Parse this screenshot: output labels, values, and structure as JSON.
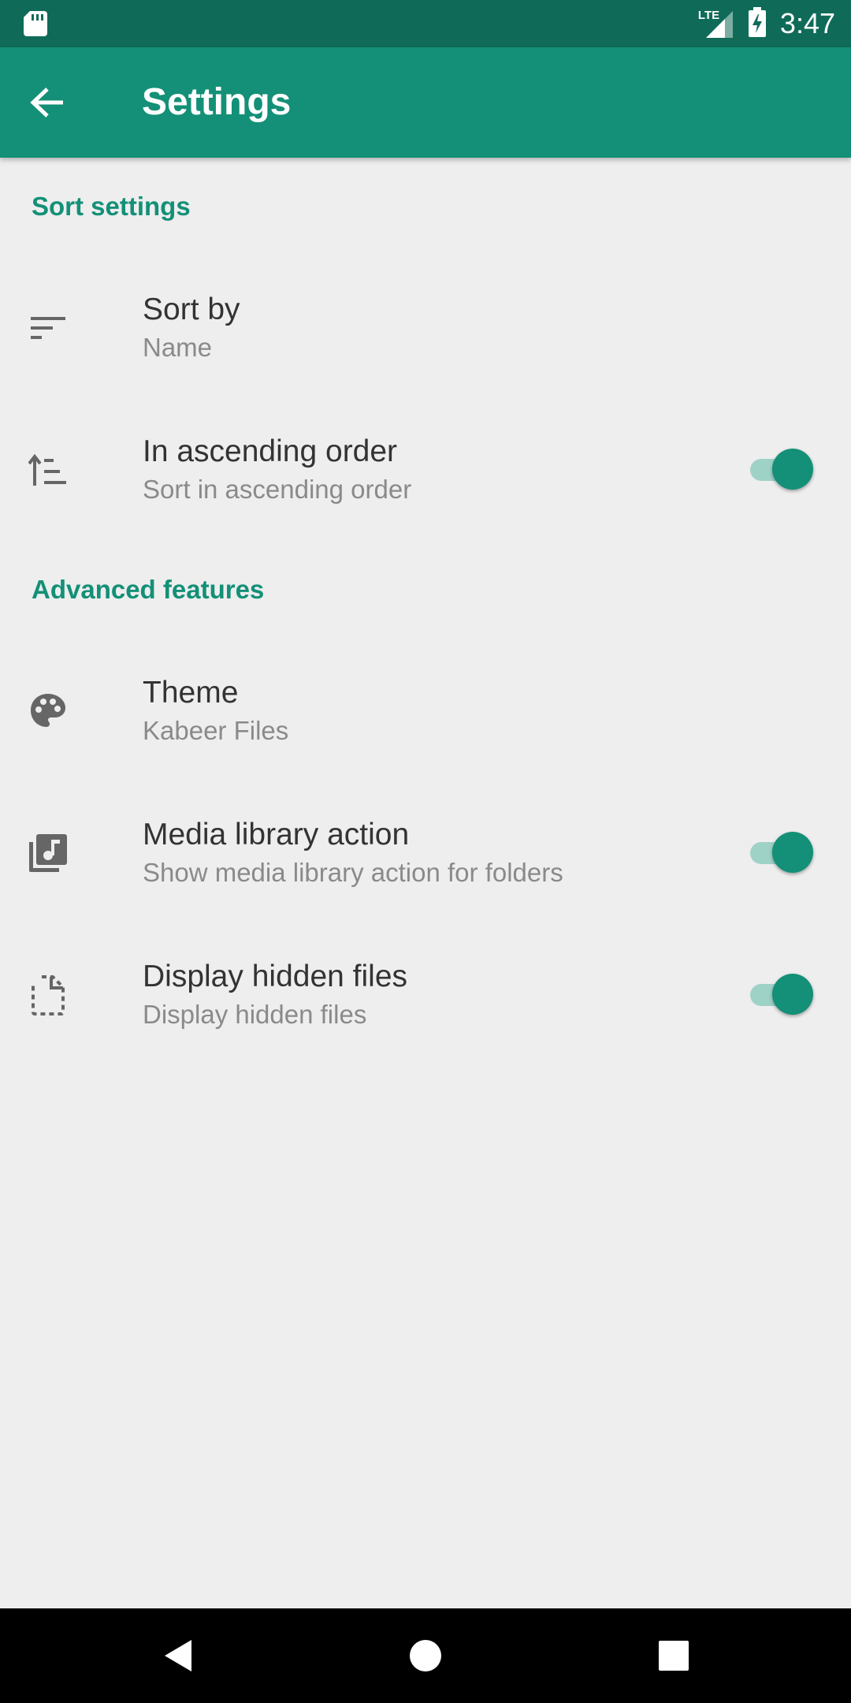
{
  "status_bar": {
    "time": "3:47",
    "network": "LTE",
    "left_icon": "sd-card-icon",
    "signal_icon": "signal-icon",
    "battery_icon": "battery-charging-icon"
  },
  "app_bar": {
    "title": "Settings",
    "back_icon": "arrow-back-icon"
  },
  "sections": [
    {
      "header": "Sort settings",
      "items": [
        {
          "title": "Sort by",
          "summary": "Name",
          "icon": "sort-icon"
        },
        {
          "title": "In ascending order",
          "summary": "Sort in ascending order",
          "icon": "sort-ascending-icon",
          "toggle": true
        }
      ]
    },
    {
      "header": "Advanced features",
      "items": [
        {
          "title": "Theme",
          "summary": "Kabeer Files",
          "icon": "palette-icon"
        },
        {
          "title": "Media library action",
          "summary": "Show media library action for folders",
          "icon": "library-music-icon",
          "toggle": true
        },
        {
          "title": "Display hidden files",
          "summary": "Display hidden files",
          "icon": "hidden-file-icon",
          "toggle": true
        }
      ]
    }
  ],
  "nav_bar": {
    "back": "nav-back-icon",
    "home": "nav-home-icon",
    "recents": "nav-recents-icon"
  },
  "colors": {
    "status_bar": "#0f6b58",
    "primary": "#139077",
    "background": "#eeeeee",
    "switch_track": "#9fd2c7",
    "title_text": "#333333",
    "summary_text": "#8a8a8a",
    "icon": "#666666"
  }
}
